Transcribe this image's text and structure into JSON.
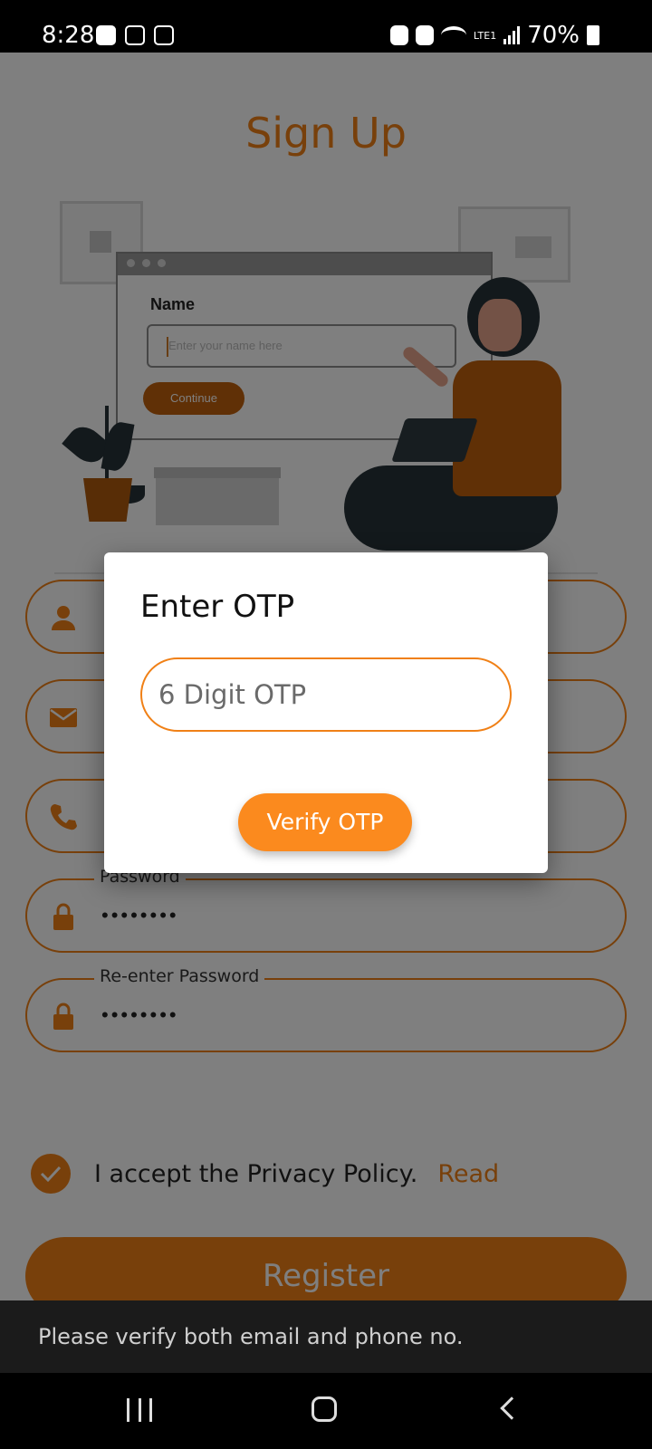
{
  "status_bar": {
    "time": "8:28",
    "battery": "70%",
    "network": "LTE1"
  },
  "page": {
    "title": "Sign Up"
  },
  "illustration": {
    "name_label": "Name",
    "name_placeholder": "Enter your name here",
    "continue_label": "Continue"
  },
  "form": {
    "fields": [
      {
        "name": "name-field",
        "icon": "person-icon",
        "label": "",
        "value": ""
      },
      {
        "name": "email-field",
        "icon": "mail-icon",
        "label": "",
        "value": ""
      },
      {
        "name": "phone-field",
        "icon": "phone-icon",
        "label": "",
        "value": ""
      },
      {
        "name": "password-field",
        "icon": "lock-icon",
        "label": "Password",
        "value": "••••••••"
      },
      {
        "name": "reenter-password-field",
        "icon": "lock-icon",
        "label": "Re-enter Password",
        "value": "••••••••"
      }
    ],
    "privacy_text": "I accept the Privacy Policy.",
    "privacy_link": "Read",
    "register_label": "Register"
  },
  "dialog": {
    "title": "Enter OTP",
    "otp_placeholder": "6 Digit OTP",
    "verify_label": "Verify OTP"
  },
  "toast": {
    "message": "Please verify both email and phone no."
  },
  "colors": {
    "accent": "#f08016",
    "toast_bg": "#1b1b1b"
  }
}
